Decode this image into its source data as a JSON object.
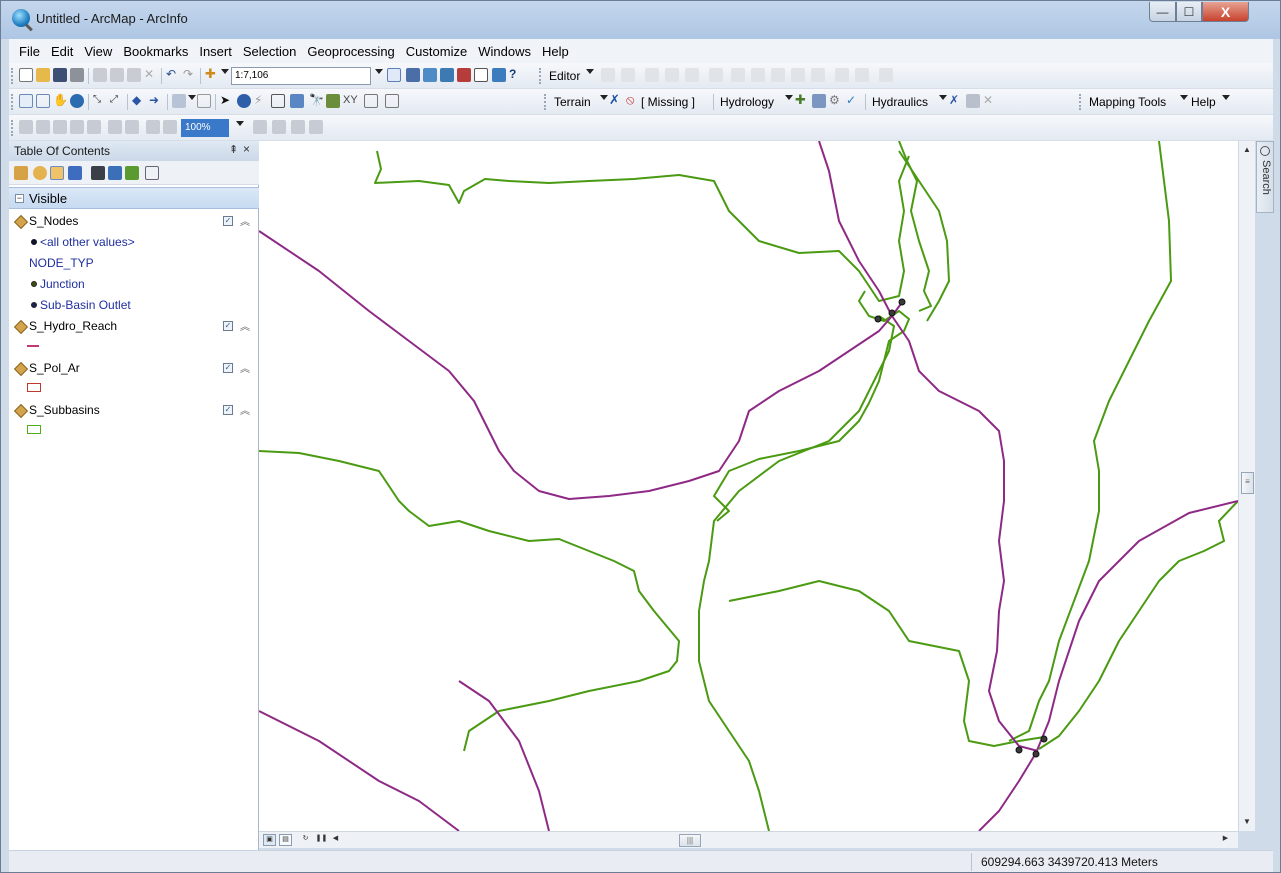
{
  "window": {
    "title": "Untitled - ArcMap - ArcInfo",
    "controls": {
      "minimize": "—",
      "maximize": "☐",
      "close": "X"
    }
  },
  "menu": [
    "File",
    "Edit",
    "View",
    "Bookmarks",
    "Insert",
    "Selection",
    "Geoprocessing",
    "Customize",
    "Windows",
    "Help"
  ],
  "toolbar": {
    "scale": "1:7,106",
    "editor_label": "Editor",
    "terrain_label": "Terrain",
    "missing_label": "[ Missing ]",
    "hydrology_label": "Hydrology",
    "hydraulics_label": "Hydraulics",
    "mapping_tools_label": "Mapping Tools",
    "help_label": "Help",
    "zoom_box": "100%"
  },
  "toc": {
    "title": "Table Of Contents",
    "group": "Visible",
    "layers": [
      {
        "name": "S_Nodes",
        "legend": [
          "<all other values>",
          "NODE_TYP",
          "Junction",
          "Sub-Basin Outlet"
        ]
      },
      {
        "name": "S_Hydro_Reach"
      },
      {
        "name": "S_Pol_Ar",
        "symbol_color": "#c0392b"
      },
      {
        "name": "S_Subbasins",
        "symbol_color": "#4caf1e"
      }
    ]
  },
  "map": {
    "reach_color": "#8e2a86",
    "subbasin_color": "#4a9a12",
    "node_color": "#3a3a3a"
  },
  "side_tab": {
    "label": "Search"
  },
  "status": {
    "coordinates": "609294.663  3439720.413 Meters"
  }
}
